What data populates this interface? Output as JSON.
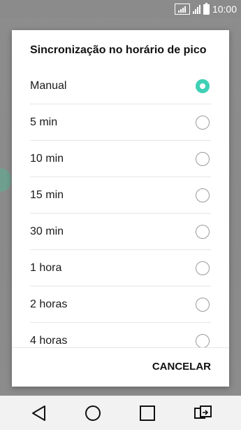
{
  "status_bar": {
    "time": "10:00",
    "icons": [
      "signal-boxed-icon",
      "signal-icon",
      "battery-icon"
    ]
  },
  "dialog": {
    "title": "Sincronização no horário de pico",
    "options": [
      {
        "label": "Manual",
        "selected": true
      },
      {
        "label": "5 min",
        "selected": false
      },
      {
        "label": "10 min",
        "selected": false
      },
      {
        "label": "15 min",
        "selected": false
      },
      {
        "label": "30 min",
        "selected": false
      },
      {
        "label": "1 hora",
        "selected": false
      },
      {
        "label": "2 horas",
        "selected": false
      },
      {
        "label": "4 horas",
        "selected": false
      }
    ],
    "cancel_label": "CANCELAR",
    "accent_color": "#3fd0b5"
  },
  "nav_bar": {
    "icons": [
      "back-icon",
      "home-icon",
      "recents-icon",
      "dual-window-icon"
    ]
  }
}
